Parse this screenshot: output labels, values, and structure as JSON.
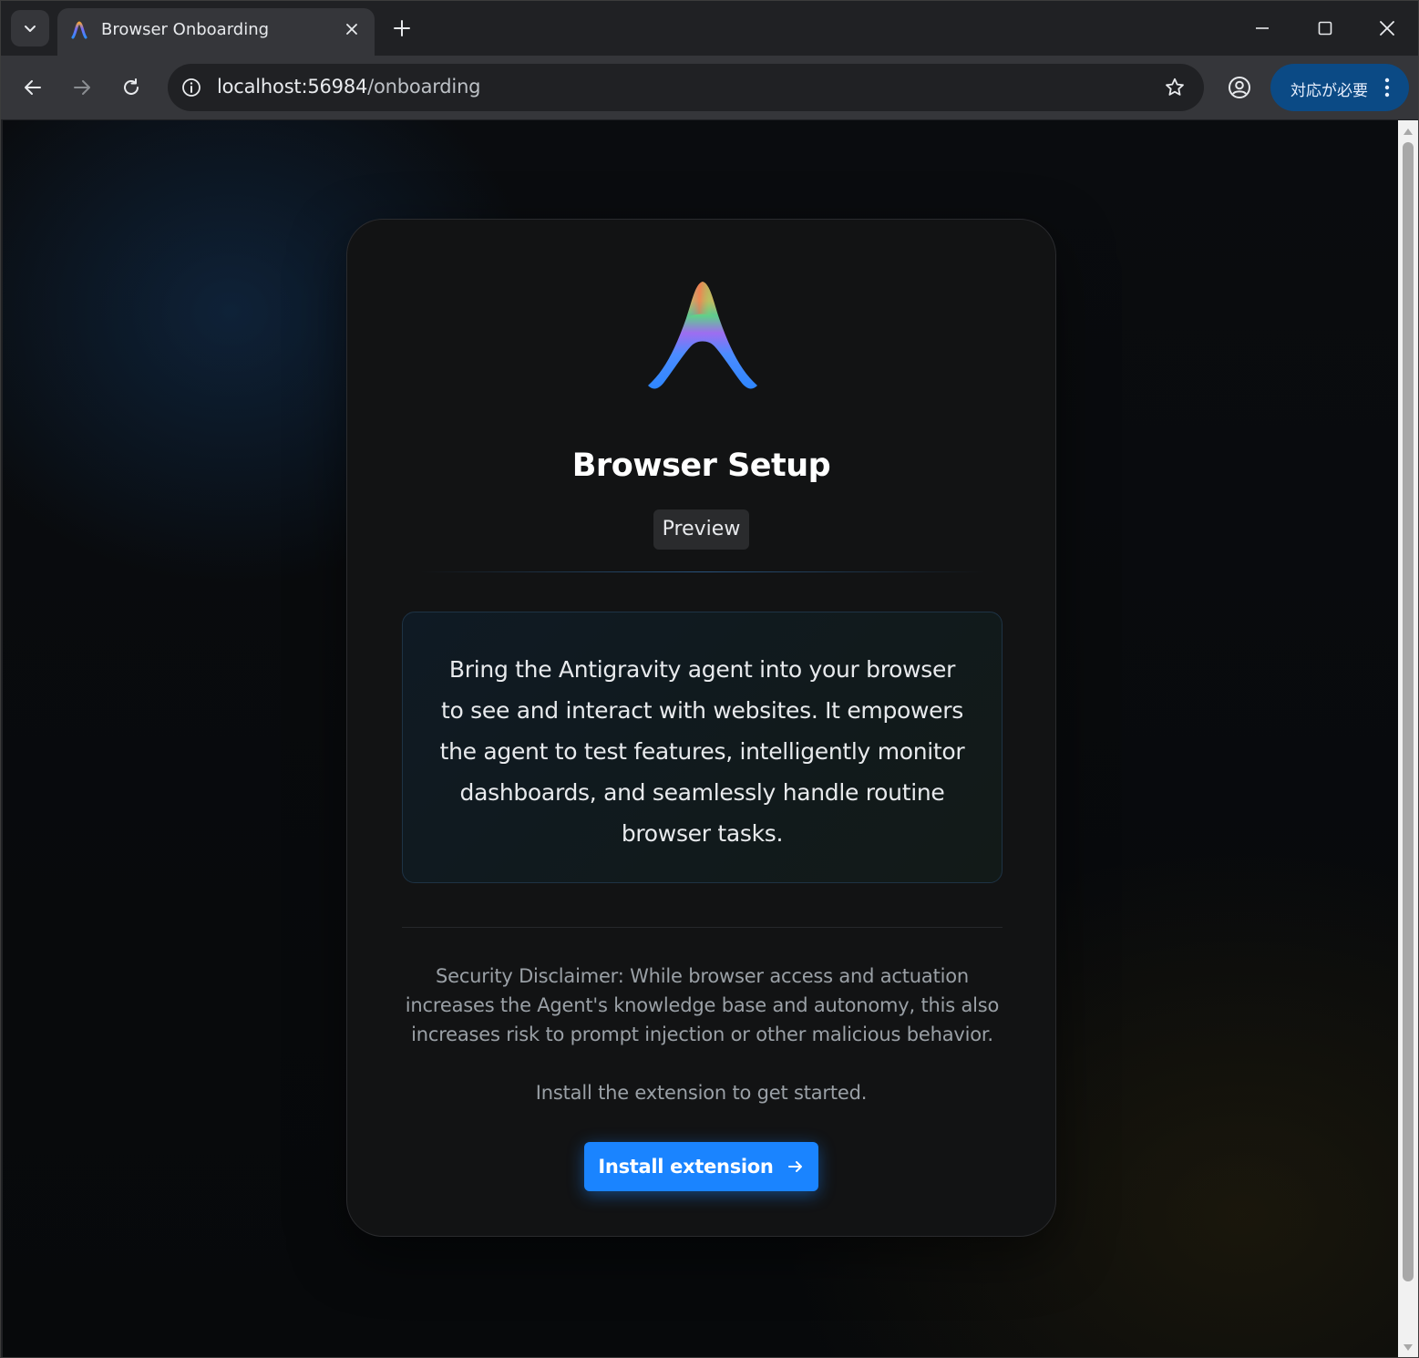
{
  "browser": {
    "tab": {
      "title": "Browser Onboarding",
      "favicon": "antigravity-logo-icon"
    },
    "address_bar": {
      "host": "localhost:56984",
      "path": "/onboarding"
    },
    "attention_button": {
      "label": "対応が必要"
    },
    "icons": {
      "tab_search": "chevron-down-icon",
      "close_tab": "close-icon",
      "new_tab": "plus-icon",
      "minimize": "minimize-icon",
      "maximize": "maximize-icon",
      "close_window": "close-icon",
      "back": "arrow-left-icon",
      "forward": "arrow-right-icon",
      "reload": "reload-icon",
      "site_info": "info-icon",
      "bookmark": "star-icon",
      "profile": "profile-icon",
      "menu": "kebab-menu-icon"
    }
  },
  "onboarding": {
    "title": "Browser Setup",
    "badge": "Preview",
    "description": "Bring the Antigravity agent into your browser to see and interact with websites. It empowers the agent to test features, intelligently monitor dashboards, and seamlessly handle routine browser tasks.",
    "disclaimer": "Security Disclaimer: While browser access and actuation increases the Agent's knowledge base and autonomy, this also increases risk to prompt injection or other malicious behavior.",
    "install_hint": "Install the extension to get started.",
    "install_button": "Install extension"
  },
  "colors": {
    "accent": "#1a84ff",
    "attention_bg": "#0b4a85",
    "card_bg": "#121314",
    "page_bg": "#08090b"
  }
}
